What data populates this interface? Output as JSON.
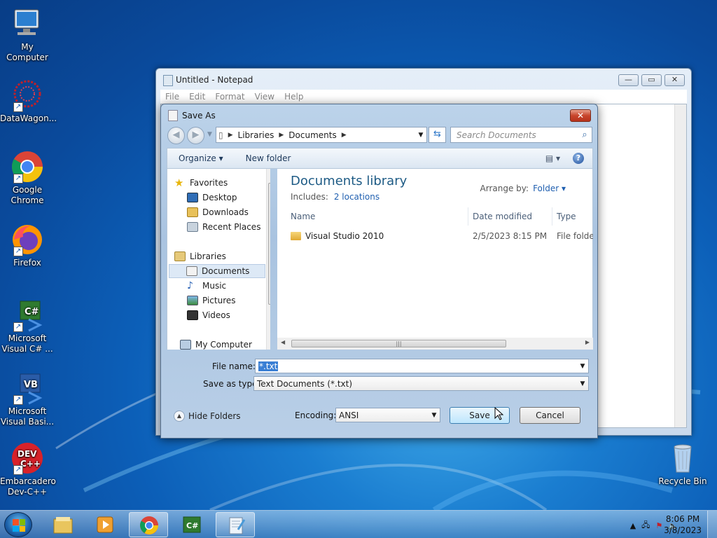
{
  "desktop": {
    "icons": [
      {
        "label": "My Computer"
      },
      {
        "label": "DataWagon..."
      },
      {
        "label": "Google Chrome"
      },
      {
        "label": "Firefox"
      },
      {
        "label": "Microsoft Visual C# ..."
      },
      {
        "label": "Microsoft Visual Basi..."
      },
      {
        "label": "Embarcadero Dev-C++"
      },
      {
        "label": "Recycle Bin"
      }
    ]
  },
  "notepad": {
    "title": "Untitled - Notepad",
    "menu": [
      "File",
      "Edit",
      "Format",
      "View",
      "Help"
    ],
    "controls": {
      "minimize": "—",
      "maximize": "▭",
      "close": "✕"
    }
  },
  "save_dialog": {
    "title": "Save As",
    "close": "✕",
    "breadcrumb": [
      "Libraries",
      "Documents"
    ],
    "search_placeholder": "Search Documents",
    "toolbar": {
      "organize": "Organize ▾",
      "new_folder": "New folder",
      "views": "▤ ▾",
      "help": "?"
    },
    "nav": {
      "favorites": "Favorites",
      "desktop": "Desktop",
      "downloads": "Downloads",
      "recent": "Recent Places",
      "libraries": "Libraries",
      "documents": "Documents",
      "music": "Music",
      "pictures": "Pictures",
      "videos": "Videos",
      "computer": "My Computer"
    },
    "library": {
      "title": "Documents library",
      "includes_label": "Includes:",
      "includes_link": "2 locations",
      "arrange_label": "Arrange by:",
      "arrange_value": "Folder ▾"
    },
    "columns": [
      "Name",
      "Date modified",
      "Type"
    ],
    "files": [
      {
        "name": "Visual Studio 2010",
        "date": "2/5/2023 8:15 PM",
        "type": "File folder"
      }
    ],
    "file_name_label": "File name:",
    "file_name_value": "*.txt",
    "save_as_type_label": "Save as type:",
    "save_as_type_value": "Text Documents (*.txt)",
    "hide_folders": "Hide Folders",
    "encoding_label": "Encoding:",
    "encoding_value": "ANSI",
    "save_button": "Save",
    "cancel_button": "Cancel"
  },
  "taskbar": {
    "clock_time": "8:06 PM",
    "clock_date": "3/8/2023",
    "tray_up": "▲"
  }
}
